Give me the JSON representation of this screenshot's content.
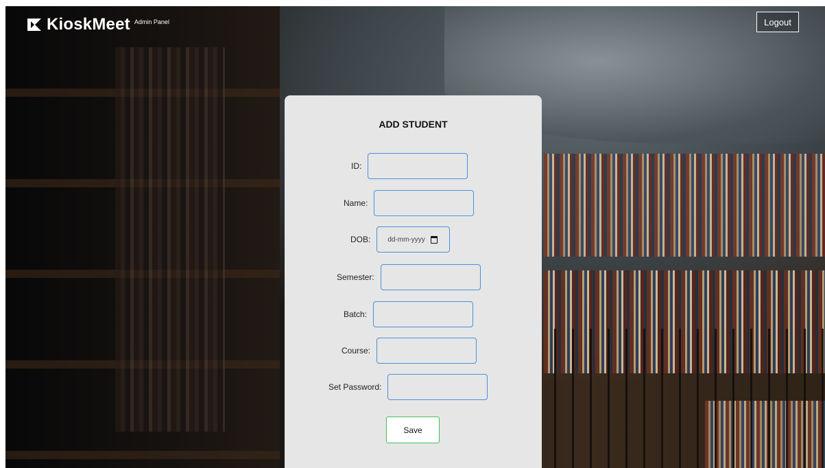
{
  "header": {
    "brand_name": "KioskMeet",
    "brand_subtitle": "Admin Panel",
    "logout_label": "Logout"
  },
  "form": {
    "title": "ADD STUDENT",
    "fields": [
      {
        "label": "ID:",
        "value": ""
      },
      {
        "label": "Name:",
        "value": ""
      },
      {
        "label": "DOB:",
        "placeholder": "dd-mm-yyyy"
      },
      {
        "label": "Semester:",
        "value": ""
      },
      {
        "label": "Batch:",
        "value": ""
      },
      {
        "label": "Course:",
        "value": ""
      },
      {
        "label": "Set Password:",
        "value": ""
      }
    ],
    "save_label": "Save"
  },
  "icons": {
    "brand": "kioskmeet-logo-icon",
    "date": "calendar-icon"
  },
  "colors": {
    "input_border": "#4a90d9",
    "save_border": "#3fbf5a",
    "card_background": "#e6e6e6"
  }
}
